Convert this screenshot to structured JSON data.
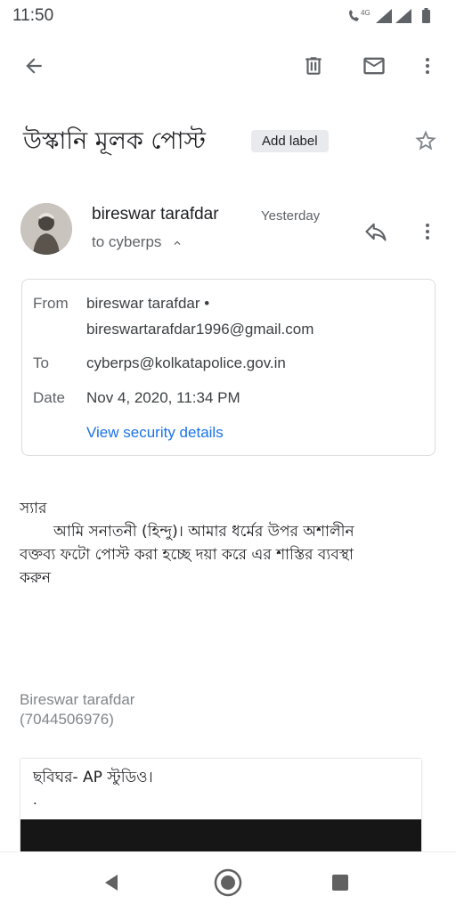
{
  "status_bar": {
    "time": "11:50",
    "network_label": "4G",
    "icons": [
      "volte-call-icon",
      "signal-icon",
      "signal-icon",
      "battery-icon"
    ]
  },
  "toolbar": {
    "icons": [
      "back-arrow-icon",
      "delete-icon",
      "mark-unread-icon",
      "more-vert-icon"
    ]
  },
  "email": {
    "subject": "উস্কানি মূলক পোস্ট",
    "label_chip": "Add label",
    "sender_name": "bireswar tarafdar",
    "sent_time": "Yesterday",
    "to_summary": "to cyberps",
    "details": {
      "from_label": "From",
      "from_name": "bireswar tarafdar •",
      "from_email": "bireswartarafdar1996@gmail.com",
      "to_label": "To",
      "to_value": "cyberps@kolkatapolice.gov.in",
      "date_label": "Date",
      "date_value": "Nov 4, 2020, 11:34 PM",
      "security_link": "View security details"
    },
    "body": {
      "salutation": "স্যার",
      "line1": "আমি সনাতনী (হিন্দু)। আমার ধর্মের উপর অশালীন",
      "line2": "বক্তব্য ফটো পোস্ট করা হচ্ছে দয়া করে এর শাস্তির ব্যবস্থা",
      "line3": "করুন"
    },
    "signature": {
      "name": "Bireswar tarafdar",
      "phone": "(7044506976)"
    },
    "attachment": {
      "caption": "ছবিঘর- AP স্টুডিও।",
      "dot": "."
    }
  },
  "colors": {
    "link": "#1a73e8",
    "chip_bg": "#e8eaed",
    "muted_text": "#5f6368"
  }
}
